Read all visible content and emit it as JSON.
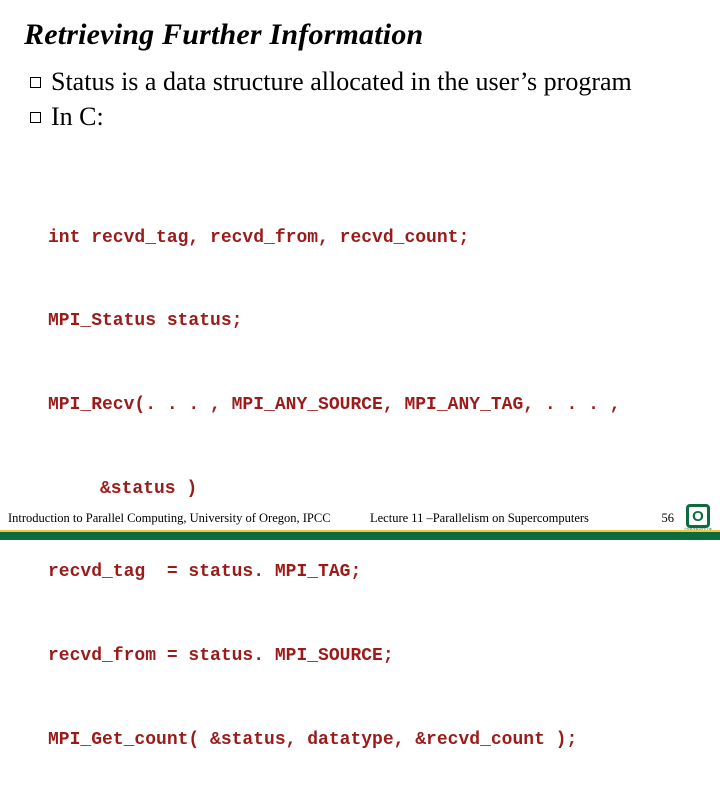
{
  "title": "Retrieving Further Information",
  "bullets": [
    "Status is a data structure allocated in the user’s program",
    "In C:"
  ],
  "code": {
    "l1": "int recvd_tag, recvd_from, recvd_count;",
    "l2": "MPI_Status status;",
    "l3": "MPI_Recv(. . . , MPI_ANY_SOURCE, MPI_ANY_TAG, . . . ,",
    "l3b": "&status )",
    "l4": "recvd_tag  = status. MPI_TAG;",
    "l5": "recvd_from = status. MPI_SOURCE;",
    "l6": "MPI_Get_count( &status, datatype, &recvd_count );"
  },
  "footer": {
    "left": "Introduction to Parallel Computing, University of Oregon, IPCC",
    "center": "Lecture 11 –Parallelism on Supercomputers",
    "page": "56",
    "logo_letter": "O",
    "logo_text": "UNIVERSITY OF OREGON"
  }
}
